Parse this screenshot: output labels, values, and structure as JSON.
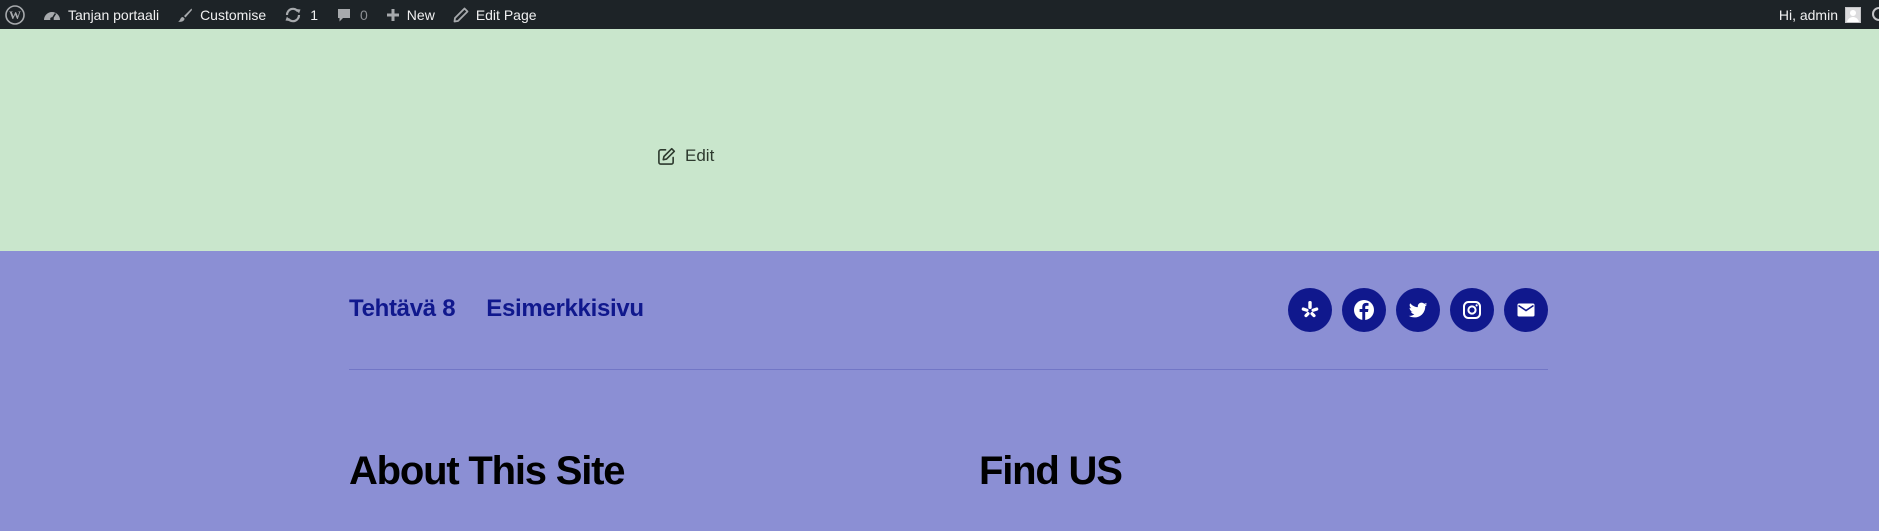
{
  "adminbar": {
    "site_name": "Tanjan portaali",
    "customise": "Customise",
    "updates_count": "1",
    "comments_count": "0",
    "new_label": "New",
    "edit_page": "Edit Page",
    "greeting": "Hi, admin"
  },
  "content": {
    "edit_label": "Edit"
  },
  "footer": {
    "nav": [
      "Tehtävä 8",
      "Esimerkkisivu"
    ],
    "social": [
      "yelp-icon",
      "facebook-icon",
      "twitter-icon",
      "instagram-icon",
      "mail-icon"
    ],
    "widgets": {
      "about_title": "About This Site",
      "find_title": "Find US"
    }
  },
  "colors": {
    "adminbar_bg": "#1d2327",
    "content_bg": "#c9e6cc",
    "footer_bg": "#8b8fd4",
    "accent": "#10188d"
  }
}
